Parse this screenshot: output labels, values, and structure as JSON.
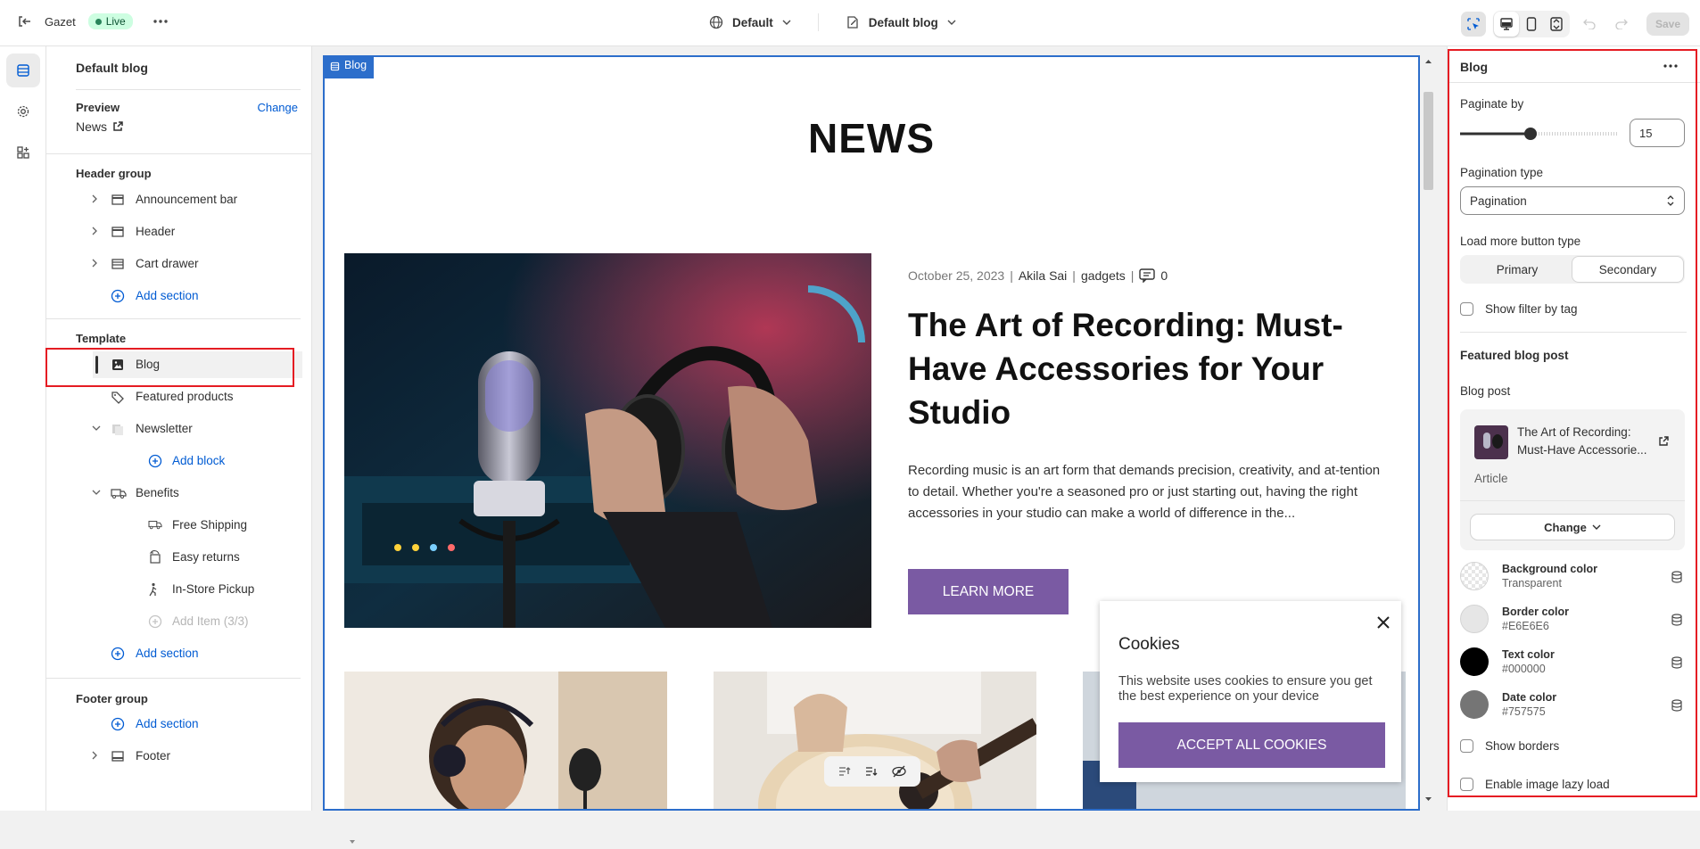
{
  "topbar": {
    "store_name": "Gazet",
    "status": "Live",
    "theme": "Default",
    "template": "Default blog",
    "save_label": "Save"
  },
  "sidebar": {
    "title": "Default blog",
    "preview_label": "Preview",
    "preview_change": "Change",
    "preview_value": "News",
    "header_group": {
      "heading": "Header group",
      "items": [
        "Announcement bar",
        "Header",
        "Cart drawer"
      ],
      "add": "Add section"
    },
    "template": {
      "heading": "Template",
      "blog": "Blog",
      "featured_products": "Featured products",
      "newsletter": "Newsletter",
      "add_block": "Add block",
      "benefits": "Benefits",
      "benefit_items": [
        "Free Shipping",
        "Easy returns",
        "In-Store Pickup"
      ],
      "add_item": "Add Item (3/3)",
      "add_section": "Add section"
    },
    "footer_group": {
      "heading": "Footer group",
      "add": "Add section",
      "footer": "Footer"
    }
  },
  "preview": {
    "section_tag": "Blog",
    "heading": "NEWS",
    "article": {
      "date": "October 25, 2023",
      "author": "Akila Sai",
      "tag": "gadgets",
      "comments": "0",
      "title": "The Art of Recording: Must-Have Accessories for Your Studio",
      "excerpt": "Recording music is an art form that demands precision, creativity, and at-tention to detail. Whether you're a seasoned pro or just starting out, having the right accessories in your studio can make a world of difference in the...",
      "button": "LEARN MORE"
    },
    "cookie": {
      "title": "Cookies",
      "text": "This website uses cookies to ensure you get the best experience on your device",
      "button": "ACCEPT ALL COOKIES"
    }
  },
  "settings": {
    "title": "Blog",
    "paginate_label": "Paginate by",
    "paginate_value": "15",
    "paginate_level": 0.45,
    "pagination_type_label": "Pagination type",
    "pagination_type_value": "Pagination",
    "load_more_label": "Load more button type",
    "load_more_options": [
      "Primary",
      "Secondary"
    ],
    "load_more_selected": "Secondary",
    "show_filter_label": "Show filter by tag",
    "featured_heading": "Featured blog post",
    "blog_post_label": "Blog post",
    "post_title": "The Art of Recording: Must-Have Accessorie...",
    "post_type": "Article",
    "change_label": "Change",
    "colors": [
      {
        "label": "Background color",
        "value": "Transparent"
      },
      {
        "label": "Border color",
        "value": "#E6E6E6"
      },
      {
        "label": "Text color",
        "value": "#000000"
      },
      {
        "label": "Date color",
        "value": "#757575"
      }
    ],
    "show_borders_label": "Show borders",
    "lazy_load_label": "Enable image lazy load"
  },
  "theme_colors": {
    "accent_button": "#7a5aa3",
    "selection_blue": "#2c6ecb",
    "highlight_red": "#e51c23",
    "link_blue": "#005bd3"
  }
}
